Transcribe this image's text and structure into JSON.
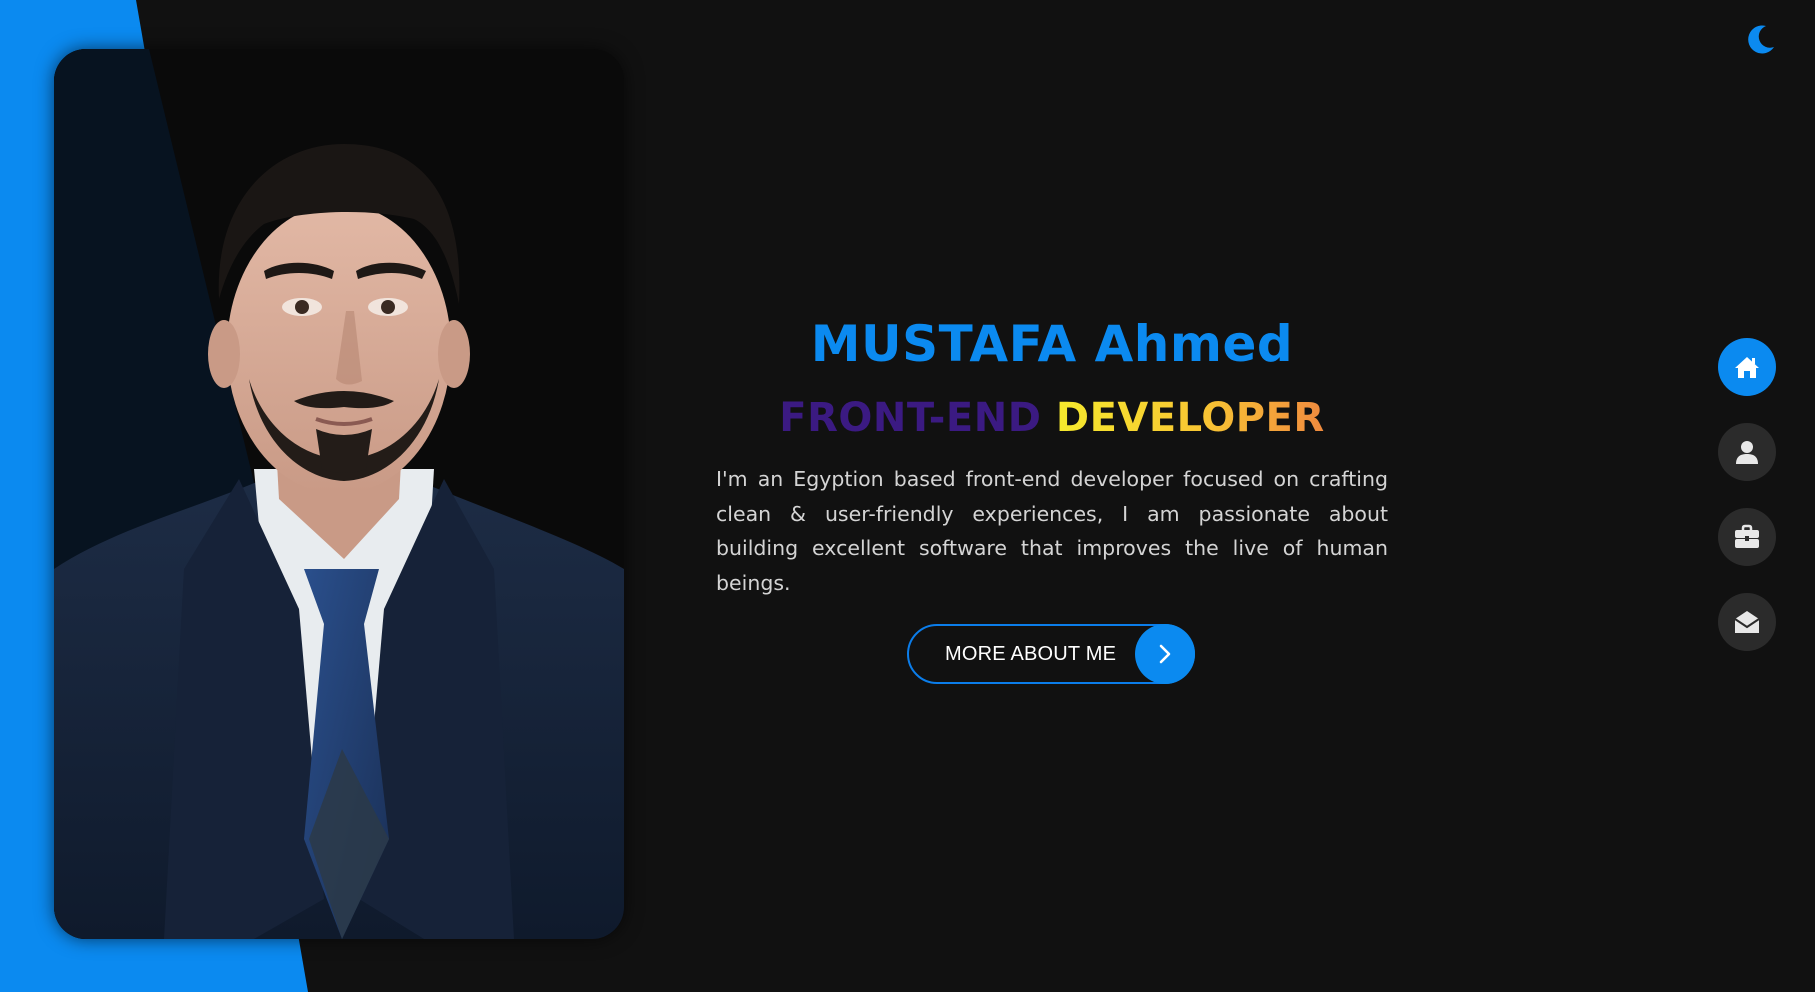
{
  "colors": {
    "accent": "#0b8af0",
    "background": "#111111",
    "stripe": "#0b8af0",
    "nav_inactive": "#2b2b2b",
    "icon_inactive": "#e8e8e8"
  },
  "theme_toggle": {
    "icon": "moon-icon"
  },
  "profile": {
    "photo_subject": "portrait of a man in a dark navy suit, white shirt and blue tie"
  },
  "hero": {
    "name": "MUSTAFA Ahmed",
    "title_part1": "FRONT-END",
    "title_part2": "DEVELOPER",
    "bio": "I'm an Egyption based front-end developer focused on crafting clean & user-friendly experiences, I am passionate about building excellent software that improves the live of human beings.",
    "cta_label": "MORE ABOUT ME",
    "cta_icon": "chevron-right-icon"
  },
  "nav": {
    "items": [
      {
        "name": "home",
        "icon": "home-icon",
        "active": true
      },
      {
        "name": "about",
        "icon": "user-icon",
        "active": false
      },
      {
        "name": "portfolio",
        "icon": "briefcase-icon",
        "active": false
      },
      {
        "name": "contact",
        "icon": "envelope-open-icon",
        "active": false
      }
    ]
  }
}
